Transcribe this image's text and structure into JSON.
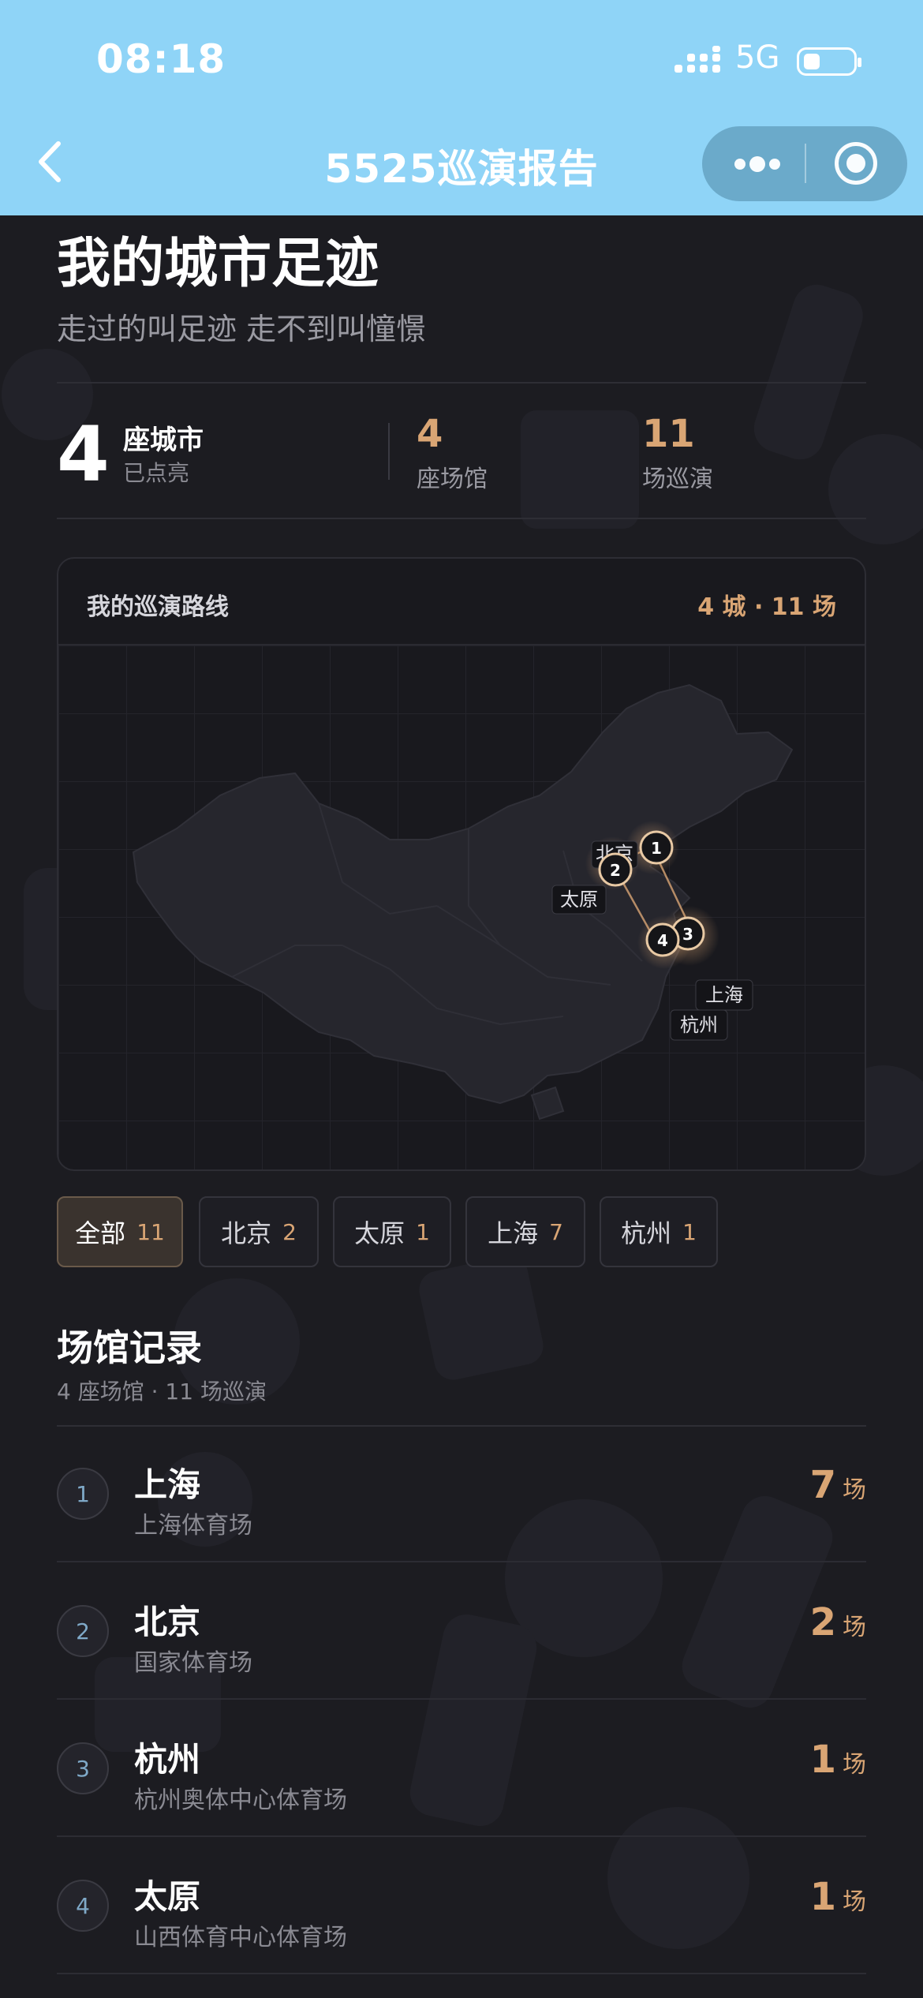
{
  "status": {
    "time": "08:18",
    "network": "5G"
  },
  "nav": {
    "title": "5525巡演报告"
  },
  "header": {
    "title": "我的城市足迹",
    "subtitle": "走过的叫足迹 走不到叫憧憬"
  },
  "stats": {
    "cities_num": "4",
    "cities_label": "座城市",
    "cities_sub": "已点亮",
    "venues_num": "4",
    "venues_label": "座场馆",
    "shows_num": "11",
    "shows_label": "场巡演"
  },
  "route_card": {
    "title": "我的巡演路线",
    "summary": "4 城 · 11 场",
    "markers": [
      {
        "n": "1",
        "city": "北京"
      },
      {
        "n": "2",
        "city": "北京"
      },
      {
        "n": "3",
        "city": "上海"
      },
      {
        "n": "4",
        "city": "杭州"
      }
    ],
    "labels": {
      "beijing": "北京",
      "taiyuan": "太原",
      "shanghai": "上海",
      "hangzhou": "杭州"
    }
  },
  "filters": [
    {
      "label": "全部",
      "count": "11",
      "active": true
    },
    {
      "label": "北京",
      "count": "2"
    },
    {
      "label": "太原",
      "count": "1"
    },
    {
      "label": "上海",
      "count": "7"
    },
    {
      "label": "杭州",
      "count": "1"
    }
  ],
  "venues_section": {
    "title": "场馆记录",
    "subtitle": "4 座场馆 · 11 场巡演"
  },
  "venues": [
    {
      "idx": "1",
      "city": "上海",
      "venue": "上海体育场",
      "count": "7",
      "unit": "场"
    },
    {
      "idx": "2",
      "city": "北京",
      "venue": "国家体育场",
      "count": "2",
      "unit": "场"
    },
    {
      "idx": "3",
      "city": "杭州",
      "venue": "杭州奥体中心体育场",
      "count": "1",
      "unit": "场"
    },
    {
      "idx": "4",
      "city": "太原",
      "venue": "山西体育中心体育场",
      "count": "1",
      "unit": "场"
    }
  ],
  "colors": {
    "accent": "#d9a574",
    "topbar": "#8fd4f7",
    "background": "#1c1c21"
  },
  "icons": [
    "back-icon",
    "signal-icon",
    "battery-icon",
    "more-icon",
    "close-target-icon"
  ]
}
